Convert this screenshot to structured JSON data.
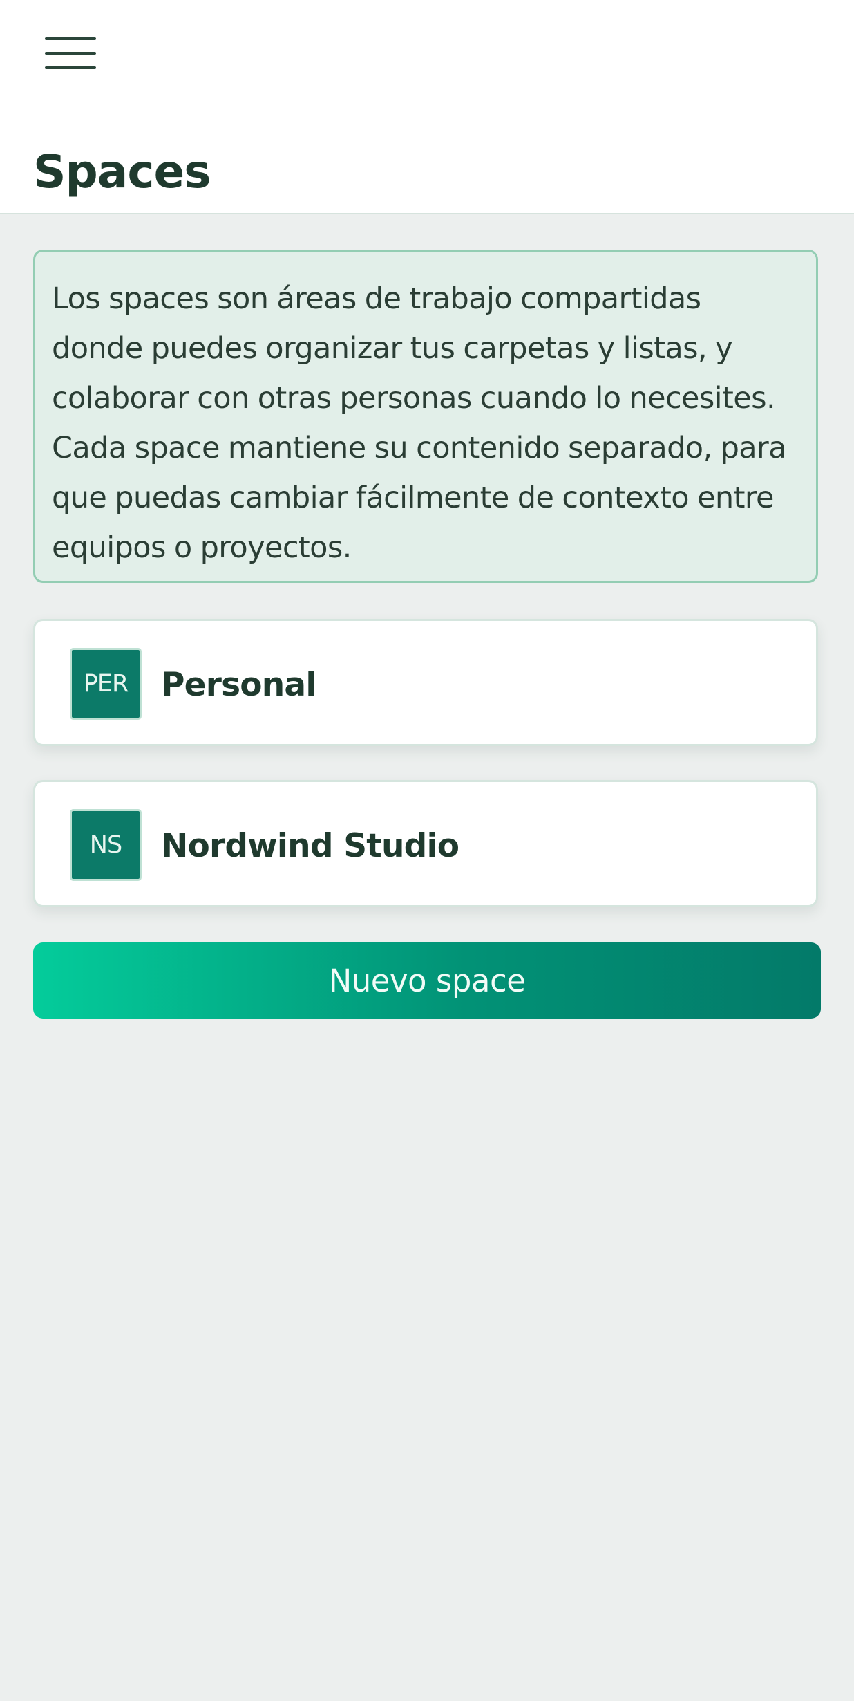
{
  "header": {
    "menu_icon": "hamburger-menu-icon",
    "title": "Spaces"
  },
  "info": {
    "text": "Los spaces son áreas de trabajo compartidas donde puedes organizar tus carpetas y listas, y colaborar con otras personas cuando lo necesites. Cada space mantiene su contenido separado, para que puedas cambiar fácilmente de contexto entre equipos o proyectos."
  },
  "spaces": [
    {
      "initials": "PER",
      "name": "Personal"
    },
    {
      "initials": "NS",
      "name": "Nordwind Studio"
    }
  ],
  "actions": {
    "new_space_label": "Nuevo space"
  },
  "colors": {
    "accent": "#0c7a68",
    "button_gradient_start": "#04cc9b",
    "button_gradient_end": "#037a69",
    "info_background": "#e2efe9",
    "info_border": "#93cdb3",
    "page_background": "#ecefee"
  }
}
